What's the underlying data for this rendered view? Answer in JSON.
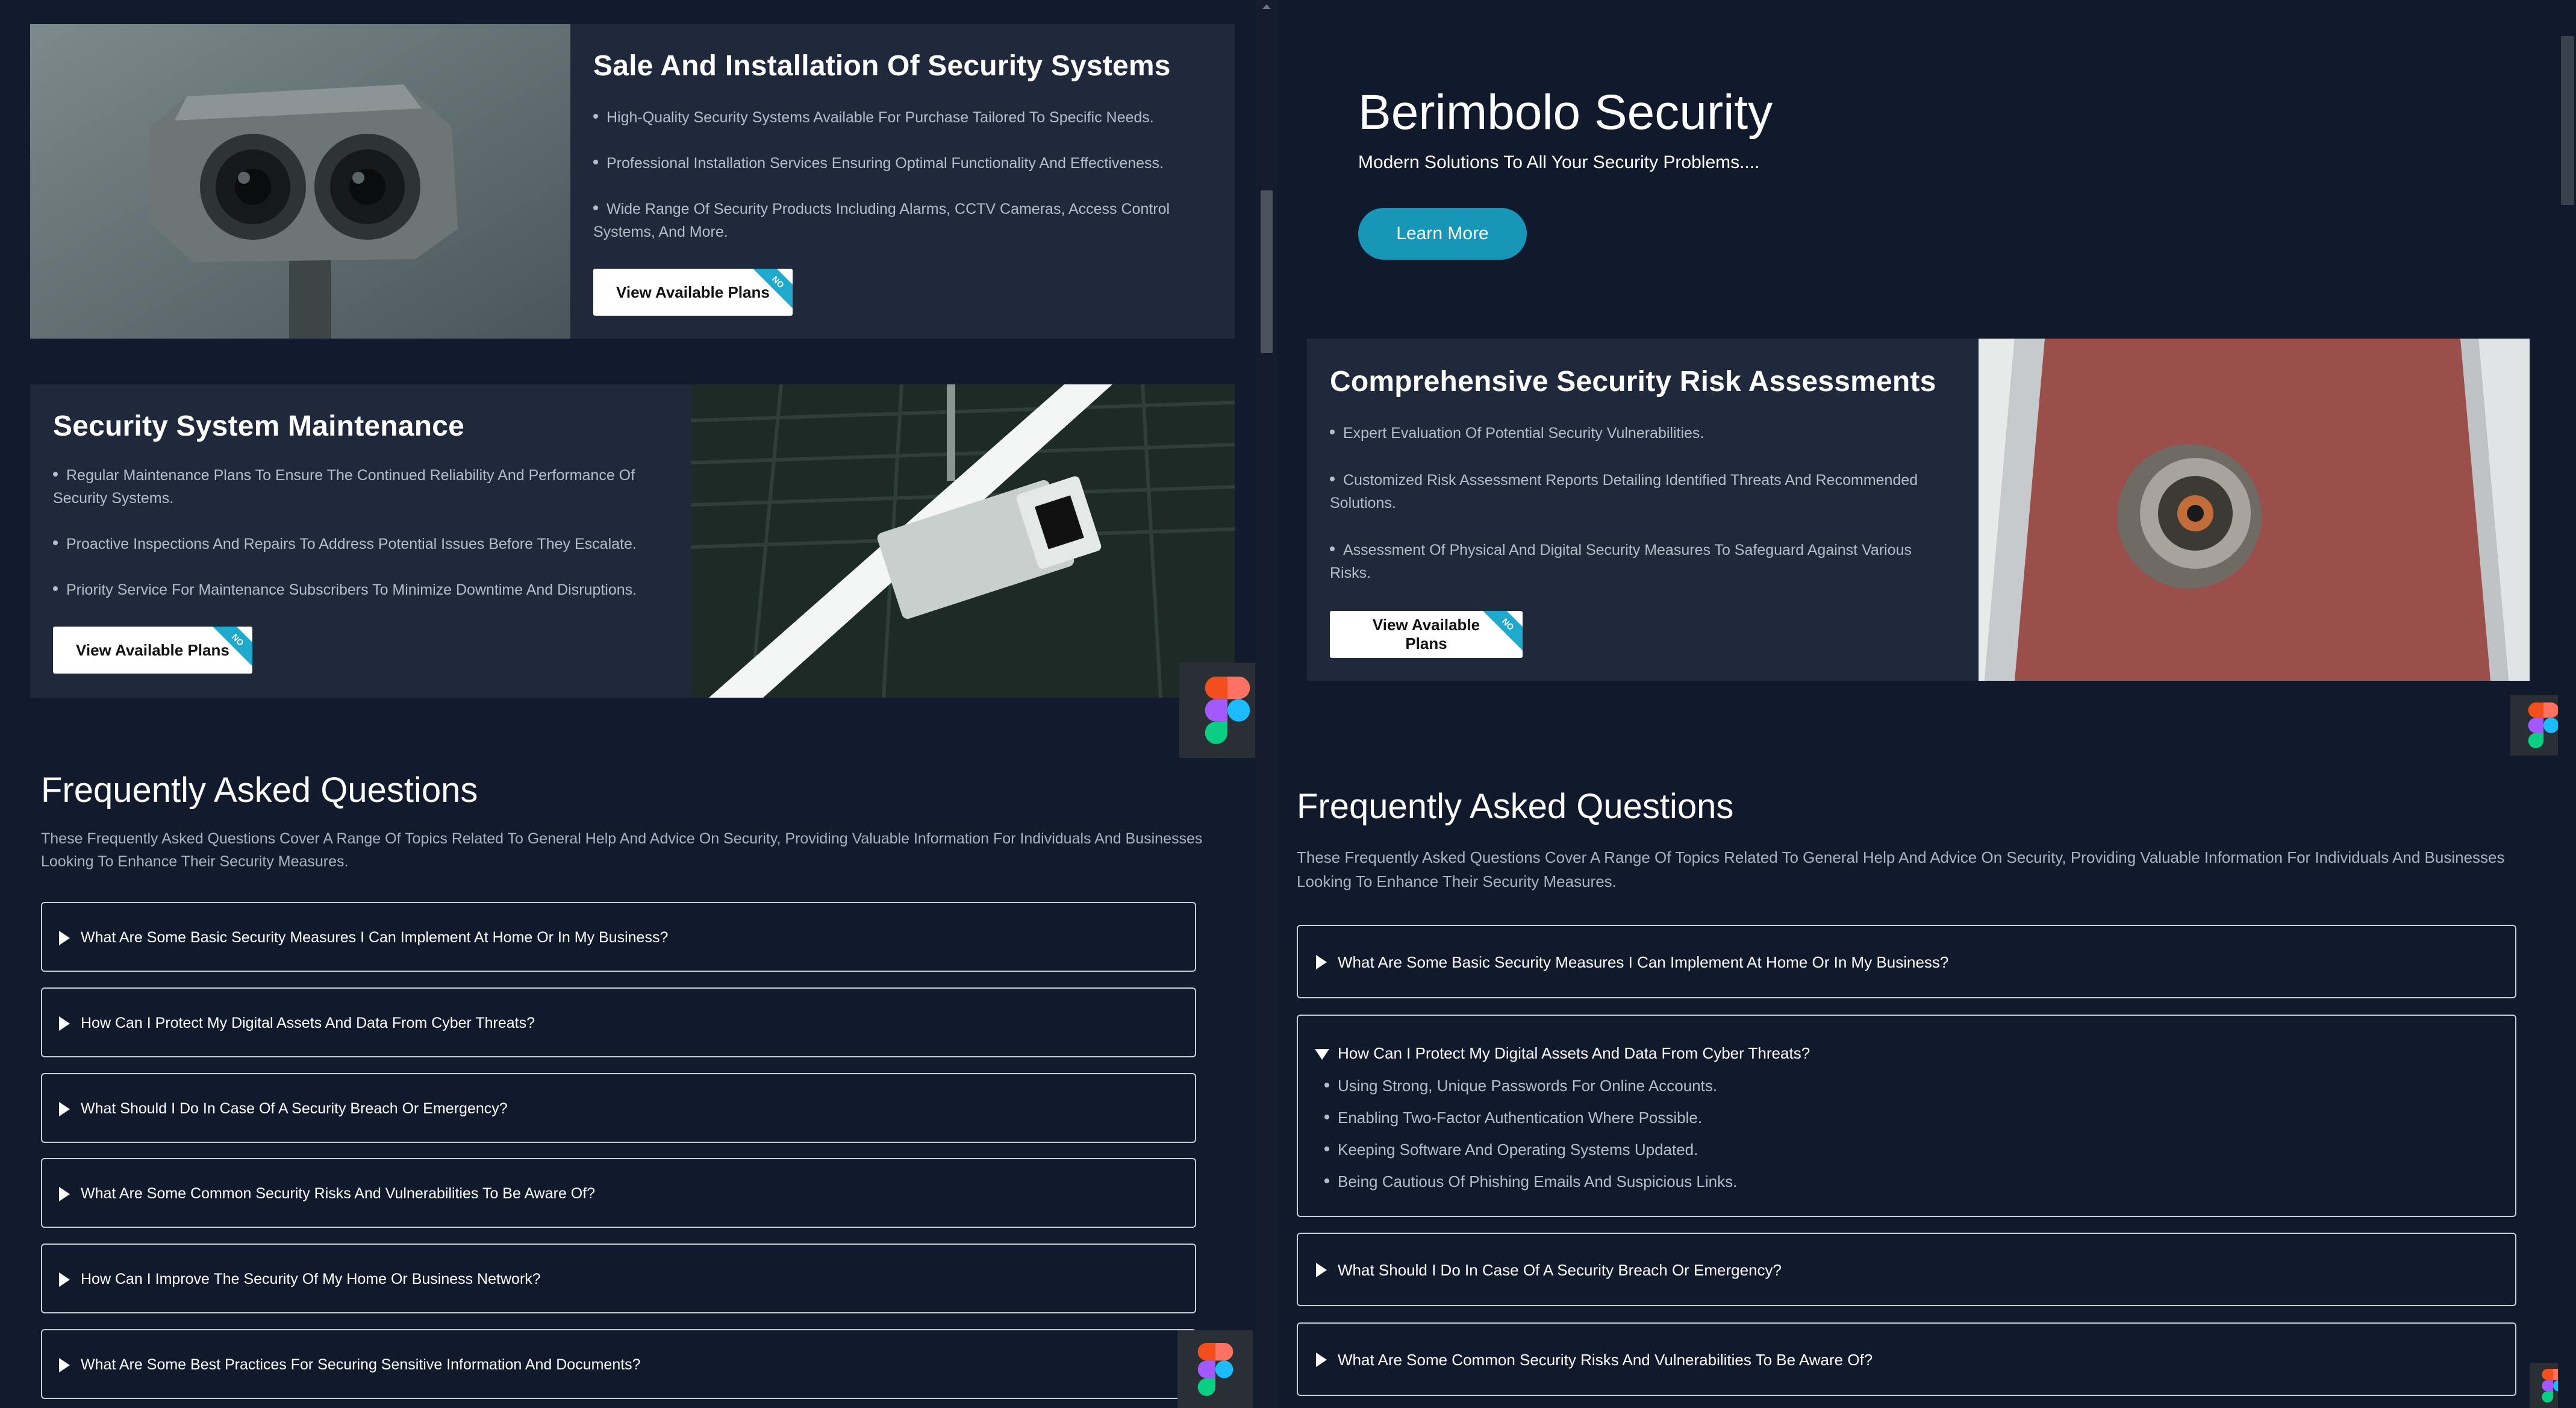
{
  "left": {
    "card_installation": {
      "title": "Sale And Installation Of Security Systems",
      "bullets": [
        "High-Quality Security Systems Available For Purchase Tailored To Specific Needs.",
        "Professional Installation Services Ensuring Optimal Functionality And Effectiveness.",
        "Wide Range Of Security Products Including Alarms, CCTV Cameras, Access Control",
        "Systems, And More."
      ],
      "button_label": "View Available Plans",
      "ribbon": "NO"
    },
    "card_maintenance": {
      "title": "Security System Maintenance",
      "bullets": [
        "Regular Maintenance Plans To Ensure The Continued Reliability And Performance Of",
        "Security Systems.",
        "Proactive Inspections And Repairs To Address Potential Issues Before They Escalate.",
        "Priority Service For Maintenance Subscribers To Minimize Downtime And Disruptions."
      ],
      "button_label": "View Available Plans",
      "ribbon": "NO"
    },
    "faq": {
      "title": "Frequently Asked Questions",
      "description_line1": "These Frequently Asked Questions Cover A Range Of Topics Related To General Help And Advice On Security, Providing Valuable Information For Individuals And Businesses",
      "description_line2": "Looking To Enhance Their Security Measures.",
      "questions": [
        "What Are Some Basic Security Measures I Can Implement At Home Or In My Business?",
        "How Can I Protect My Digital Assets And Data From Cyber Threats?",
        "What Should I Do In Case Of A Security Breach Or Emergency?",
        "What Are Some Common Security Risks And Vulnerabilities To Be Aware Of?",
        "How Can I Improve The Security Of My Home Or Business Network?",
        "What Are Some Best Practices For Securing Sensitive Information And Documents?"
      ]
    }
  },
  "right": {
    "hero": {
      "title": "Berimbolo Security",
      "subtitle": "Modern Solutions To All Your Security Problems....",
      "button_label": "Learn More"
    },
    "card_risk": {
      "title": "Comprehensive Security Risk Assessments",
      "bullets": [
        "Expert Evaluation Of Potential Security Vulnerabilities.",
        "Customized Risk Assessment Reports Detailing Identified Threats And Recommended",
        "Solutions.",
        "Assessment Of Physical And Digital Security Measures To Safeguard Against Various",
        "Risks."
      ],
      "button_label": "View Available Plans",
      "ribbon": "NO"
    },
    "faq": {
      "title": "Frequently Asked Questions",
      "description_line1": "These Frequently Asked Questions Cover A Range Of Topics Related To General Help And Advice On Security, Providing Valuable Information For Individuals And Businesses",
      "description_line2": "Looking To Enhance Their Security Measures.",
      "questions": [
        "What Are Some Basic Security Measures I Can Implement At Home Or In My Business?",
        "How Can I Protect My Digital Assets And Data From Cyber Threats?",
        "What Should I Do In Case Of A Security Breach Or Emergency?",
        "What Are Some Common Security Risks And Vulnerabilities To Be Aware Of?"
      ],
      "expanded_answers": [
        "Using Strong, Unique Passwords For Online Accounts.",
        "Enabling Two-Factor Authentication Where Possible.",
        "Keeping Software And Operating Systems Updated.",
        "Being Cautious Of Phishing Emails And Suspicious Links."
      ]
    }
  },
  "colors": {
    "page_bg": "#121a2d",
    "card_bg": "#1f293b",
    "accent": "#1896b7",
    "ribbon": "#1fa9cc",
    "faq_border": "#c9ced8"
  },
  "icons": [
    "figma-icon",
    "bullet-dot",
    "expand-triangle-icon",
    "collapse-triangle-icon"
  ]
}
